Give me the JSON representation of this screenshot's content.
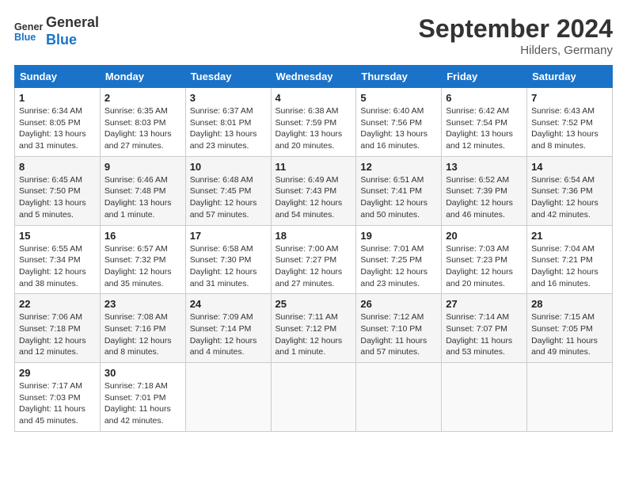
{
  "header": {
    "logo_line1": "General",
    "logo_line2": "Blue",
    "month": "September 2024",
    "location": "Hilders, Germany"
  },
  "weekdays": [
    "Sunday",
    "Monday",
    "Tuesday",
    "Wednesday",
    "Thursday",
    "Friday",
    "Saturday"
  ],
  "weeks": [
    [
      {
        "day": 1,
        "info": "Sunrise: 6:34 AM\nSunset: 8:05 PM\nDaylight: 13 hours\nand 31 minutes."
      },
      {
        "day": 2,
        "info": "Sunrise: 6:35 AM\nSunset: 8:03 PM\nDaylight: 13 hours\nand 27 minutes."
      },
      {
        "day": 3,
        "info": "Sunrise: 6:37 AM\nSunset: 8:01 PM\nDaylight: 13 hours\nand 23 minutes."
      },
      {
        "day": 4,
        "info": "Sunrise: 6:38 AM\nSunset: 7:59 PM\nDaylight: 13 hours\nand 20 minutes."
      },
      {
        "day": 5,
        "info": "Sunrise: 6:40 AM\nSunset: 7:56 PM\nDaylight: 13 hours\nand 16 minutes."
      },
      {
        "day": 6,
        "info": "Sunrise: 6:42 AM\nSunset: 7:54 PM\nDaylight: 13 hours\nand 12 minutes."
      },
      {
        "day": 7,
        "info": "Sunrise: 6:43 AM\nSunset: 7:52 PM\nDaylight: 13 hours\nand 8 minutes."
      }
    ],
    [
      {
        "day": 8,
        "info": "Sunrise: 6:45 AM\nSunset: 7:50 PM\nDaylight: 13 hours\nand 5 minutes."
      },
      {
        "day": 9,
        "info": "Sunrise: 6:46 AM\nSunset: 7:48 PM\nDaylight: 13 hours\nand 1 minute."
      },
      {
        "day": 10,
        "info": "Sunrise: 6:48 AM\nSunset: 7:45 PM\nDaylight: 12 hours\nand 57 minutes."
      },
      {
        "day": 11,
        "info": "Sunrise: 6:49 AM\nSunset: 7:43 PM\nDaylight: 12 hours\nand 54 minutes."
      },
      {
        "day": 12,
        "info": "Sunrise: 6:51 AM\nSunset: 7:41 PM\nDaylight: 12 hours\nand 50 minutes."
      },
      {
        "day": 13,
        "info": "Sunrise: 6:52 AM\nSunset: 7:39 PM\nDaylight: 12 hours\nand 46 minutes."
      },
      {
        "day": 14,
        "info": "Sunrise: 6:54 AM\nSunset: 7:36 PM\nDaylight: 12 hours\nand 42 minutes."
      }
    ],
    [
      {
        "day": 15,
        "info": "Sunrise: 6:55 AM\nSunset: 7:34 PM\nDaylight: 12 hours\nand 38 minutes."
      },
      {
        "day": 16,
        "info": "Sunrise: 6:57 AM\nSunset: 7:32 PM\nDaylight: 12 hours\nand 35 minutes."
      },
      {
        "day": 17,
        "info": "Sunrise: 6:58 AM\nSunset: 7:30 PM\nDaylight: 12 hours\nand 31 minutes."
      },
      {
        "day": 18,
        "info": "Sunrise: 7:00 AM\nSunset: 7:27 PM\nDaylight: 12 hours\nand 27 minutes."
      },
      {
        "day": 19,
        "info": "Sunrise: 7:01 AM\nSunset: 7:25 PM\nDaylight: 12 hours\nand 23 minutes."
      },
      {
        "day": 20,
        "info": "Sunrise: 7:03 AM\nSunset: 7:23 PM\nDaylight: 12 hours\nand 20 minutes."
      },
      {
        "day": 21,
        "info": "Sunrise: 7:04 AM\nSunset: 7:21 PM\nDaylight: 12 hours\nand 16 minutes."
      }
    ],
    [
      {
        "day": 22,
        "info": "Sunrise: 7:06 AM\nSunset: 7:18 PM\nDaylight: 12 hours\nand 12 minutes."
      },
      {
        "day": 23,
        "info": "Sunrise: 7:08 AM\nSunset: 7:16 PM\nDaylight: 12 hours\nand 8 minutes."
      },
      {
        "day": 24,
        "info": "Sunrise: 7:09 AM\nSunset: 7:14 PM\nDaylight: 12 hours\nand 4 minutes."
      },
      {
        "day": 25,
        "info": "Sunrise: 7:11 AM\nSunset: 7:12 PM\nDaylight: 12 hours\nand 1 minute."
      },
      {
        "day": 26,
        "info": "Sunrise: 7:12 AM\nSunset: 7:10 PM\nDaylight: 11 hours\nand 57 minutes."
      },
      {
        "day": 27,
        "info": "Sunrise: 7:14 AM\nSunset: 7:07 PM\nDaylight: 11 hours\nand 53 minutes."
      },
      {
        "day": 28,
        "info": "Sunrise: 7:15 AM\nSunset: 7:05 PM\nDaylight: 11 hours\nand 49 minutes."
      }
    ],
    [
      {
        "day": 29,
        "info": "Sunrise: 7:17 AM\nSunset: 7:03 PM\nDaylight: 11 hours\nand 45 minutes."
      },
      {
        "day": 30,
        "info": "Sunrise: 7:18 AM\nSunset: 7:01 PM\nDaylight: 11 hours\nand 42 minutes."
      },
      null,
      null,
      null,
      null,
      null
    ]
  ]
}
